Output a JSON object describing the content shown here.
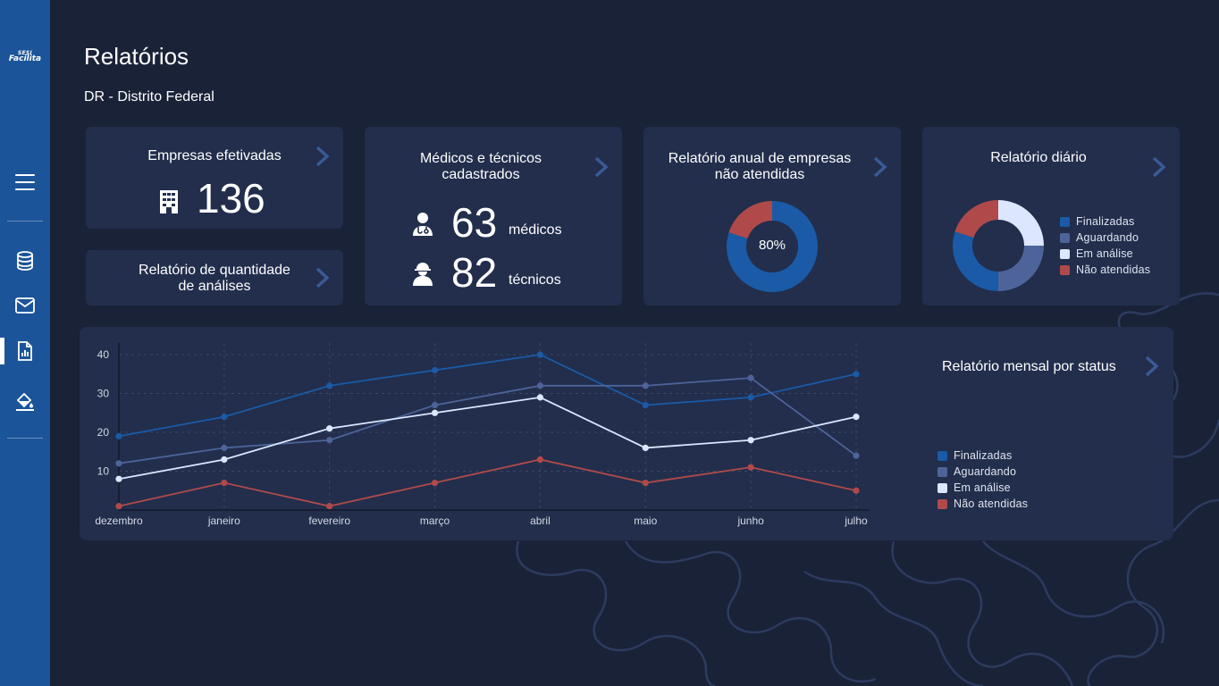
{
  "sidebar": {
    "logo_line1": "SESI",
    "logo_line2": "Facilita",
    "items": [
      {
        "icon": "menu-icon"
      },
      {
        "icon": "database-icon"
      },
      {
        "icon": "mail-icon"
      },
      {
        "icon": "report-icon",
        "active": true
      },
      {
        "icon": "paint-bucket-icon"
      }
    ]
  },
  "header": {
    "title": "Relatórios",
    "subtitle": "DR - Distrito Federal"
  },
  "cards": {
    "empresas": {
      "title": "Empresas efetivadas",
      "value": "136",
      "icon": "building-icon"
    },
    "analises": {
      "title_line1": "Relatório de quantidade",
      "title_line2": "de análises"
    },
    "medicos": {
      "title_line1": "Médicos e técnicos",
      "title_line2": "cadastrados",
      "medicos_value": "63",
      "medicos_unit": "médicos",
      "tecnicos_value": "82",
      "tecnicos_unit": "técnicos"
    },
    "anual": {
      "title_line1": "Relatório anual de empresas",
      "title_line2": "não atendidas",
      "center_label": "80%",
      "percent": 80
    },
    "diario": {
      "title": "Relatório diário"
    },
    "mensal": {
      "title": "Relatório mensal por status"
    }
  },
  "legend": [
    "Finalizadas",
    "Aguardando",
    "Em análise",
    "Não atendidas"
  ],
  "colors": {
    "finalizadas": "#1a5aa6",
    "aguardando": "#4d6399",
    "em_analise": "#dce6ff",
    "nao_atendidas": "#b04a4a",
    "sidebar": "#1b5499",
    "background": "#1a2238",
    "card": "#222e4c"
  },
  "chart_data": [
    {
      "type": "pie",
      "labels": [
        "Finalizadas",
        "Não atendidas"
      ],
      "values": [
        80,
        20
      ],
      "center_label": "80%"
    },
    {
      "type": "pie",
      "labels": [
        "Finalizadas",
        "Aguardando",
        "Em análise",
        "Não atendidas"
      ],
      "values": [
        30,
        25,
        25,
        20
      ]
    },
    {
      "type": "line",
      "title": "Relatório mensal por status",
      "categories": [
        "dezembro",
        "janeiro",
        "fevereiro",
        "março",
        "abril",
        "maio",
        "junho",
        "julho"
      ],
      "yticks": [
        10,
        20,
        30,
        40
      ],
      "ylim": [
        0,
        43
      ],
      "grid": true,
      "legend_position": "right",
      "series": [
        {
          "name": "Finalizadas",
          "values": [
            19,
            24,
            32,
            36,
            40,
            27,
            29,
            35
          ]
        },
        {
          "name": "Aguardando",
          "values": [
            12,
            16,
            18,
            27,
            32,
            32,
            34,
            14
          ]
        },
        {
          "name": "Em análise",
          "values": [
            8,
            13,
            21,
            25,
            29,
            16,
            18,
            24
          ]
        },
        {
          "name": "Não atendidas",
          "values": [
            1,
            7,
            1,
            7,
            13,
            7,
            11,
            5
          ]
        }
      ]
    }
  ]
}
